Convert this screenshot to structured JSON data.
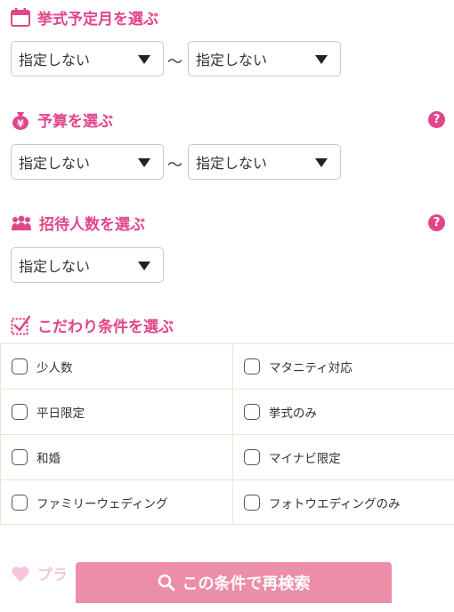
{
  "wedding_month": {
    "title": "挙式予定月を選ぶ",
    "from": "指定しない",
    "to": "指定しない",
    "separator": "〜"
  },
  "budget": {
    "title": "予算を選ぶ",
    "icon_char": "¥",
    "help": "?",
    "from": "指定しない",
    "to": "指定しない",
    "separator": "〜"
  },
  "guests": {
    "title": "招待人数を選ぶ",
    "help": "?",
    "value": "指定しない"
  },
  "preferences": {
    "title": "こだわり条件を選ぶ",
    "items": [
      "少人数",
      "マタニティ対応",
      "平日限定",
      "挙式のみ",
      "和婚",
      "マイナビ限定",
      "ファミリーウェディング",
      "フォトウエディングのみ"
    ]
  },
  "plan_section": {
    "title": "プラ"
  },
  "search_button": {
    "label": "この条件で再検索"
  },
  "colors": {
    "accent": "#e0468a",
    "button": "#ec8ea8",
    "divider": "#f1e2d2"
  },
  "icons": [
    "calendar-icon",
    "money-bag-icon",
    "people-icon",
    "checkbox-icon",
    "heart-icon",
    "search-icon",
    "help-icon",
    "dropdown-arrow-icon"
  ]
}
